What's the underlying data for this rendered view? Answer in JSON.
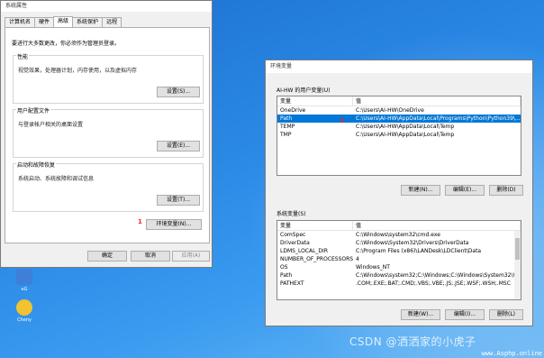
{
  "sysprop": {
    "title": "系统属性",
    "tabs": [
      "计算机名",
      "硬件",
      "高级",
      "系统保护",
      "远程"
    ],
    "admin_note": "要进行大多数更改，你必须作为管理员登录。",
    "performance": {
      "title": "性能",
      "desc": "视觉效果，处理器计划，内存使用，以及虚拟内存",
      "button": "设置(S)..."
    },
    "profiles": {
      "title": "用户配置文件",
      "desc": "与登录帐户相关的桌面设置",
      "button": "设置(E)..."
    },
    "startup": {
      "title": "启动和故障恢复",
      "desc": "系统启动、系统故障和调试信息",
      "button": "设置(T)..."
    },
    "env_button": "环境变量(N)...",
    "marker1": "1",
    "ok": "确定",
    "cancel": "取消",
    "apply": "应用(A)"
  },
  "desktop": {
    "icons": [
      {
        "label": "eG",
        "icon": "app-icon"
      },
      {
        "label": "Cheny",
        "icon": "user-icon"
      }
    ]
  },
  "env": {
    "title": "环境变量",
    "user_section": "AI-HW 的用户变量(U)",
    "columns": [
      "变量",
      "值"
    ],
    "user_vars": [
      {
        "name": "OneDrive",
        "value": "C:\\Users\\AI-HW\\OneDrive"
      },
      {
        "name": "Path",
        "value": "C:\\Users\\AI-HW\\AppData\\Local\\Programs\\Python\\Python39\\..."
      },
      {
        "name": "TEMP",
        "value": "C:\\Users\\AI-HW\\AppData\\Local\\Temp"
      },
      {
        "name": "TMP",
        "value": "C:\\Users\\AI-HW\\AppData\\Local\\Temp"
      }
    ],
    "marker2": "2",
    "user_buttons": {
      "new": "新建(N)...",
      "edit": "编辑(E)...",
      "delete": "删除(D)"
    },
    "system_section": "系统变量(S)",
    "system_vars": [
      {
        "name": "ComSpec",
        "value": "C:\\Windows\\system32\\cmd.exe"
      },
      {
        "name": "DriverData",
        "value": "C:\\Windows\\System32\\Drivers\\DriverData"
      },
      {
        "name": "LDMS_LOCAL_DIR",
        "value": "C:\\Program Files (x86)\\LANDesk\\LDClient\\Data"
      },
      {
        "name": "NUMBER_OF_PROCESSORS",
        "value": "4"
      },
      {
        "name": "OS",
        "value": "Windows_NT"
      },
      {
        "name": "Path",
        "value": "C:\\Windows\\system32;C:\\Windows;C:\\Windows\\System32\\Wb..."
      },
      {
        "name": "PATHEXT",
        "value": ".COM;.EXE;.BAT;.CMD;.VBS;.VBE;.JS;.JSE;.WSF;.WSH;.MSC"
      }
    ],
    "system_buttons": {
      "new": "新建(W)...",
      "edit": "编辑(I)...",
      "delete": "删除(L)"
    }
  },
  "watermark": "CSDN @洒洒家的小虎子",
  "watermark_site": "www.Asphp.online"
}
